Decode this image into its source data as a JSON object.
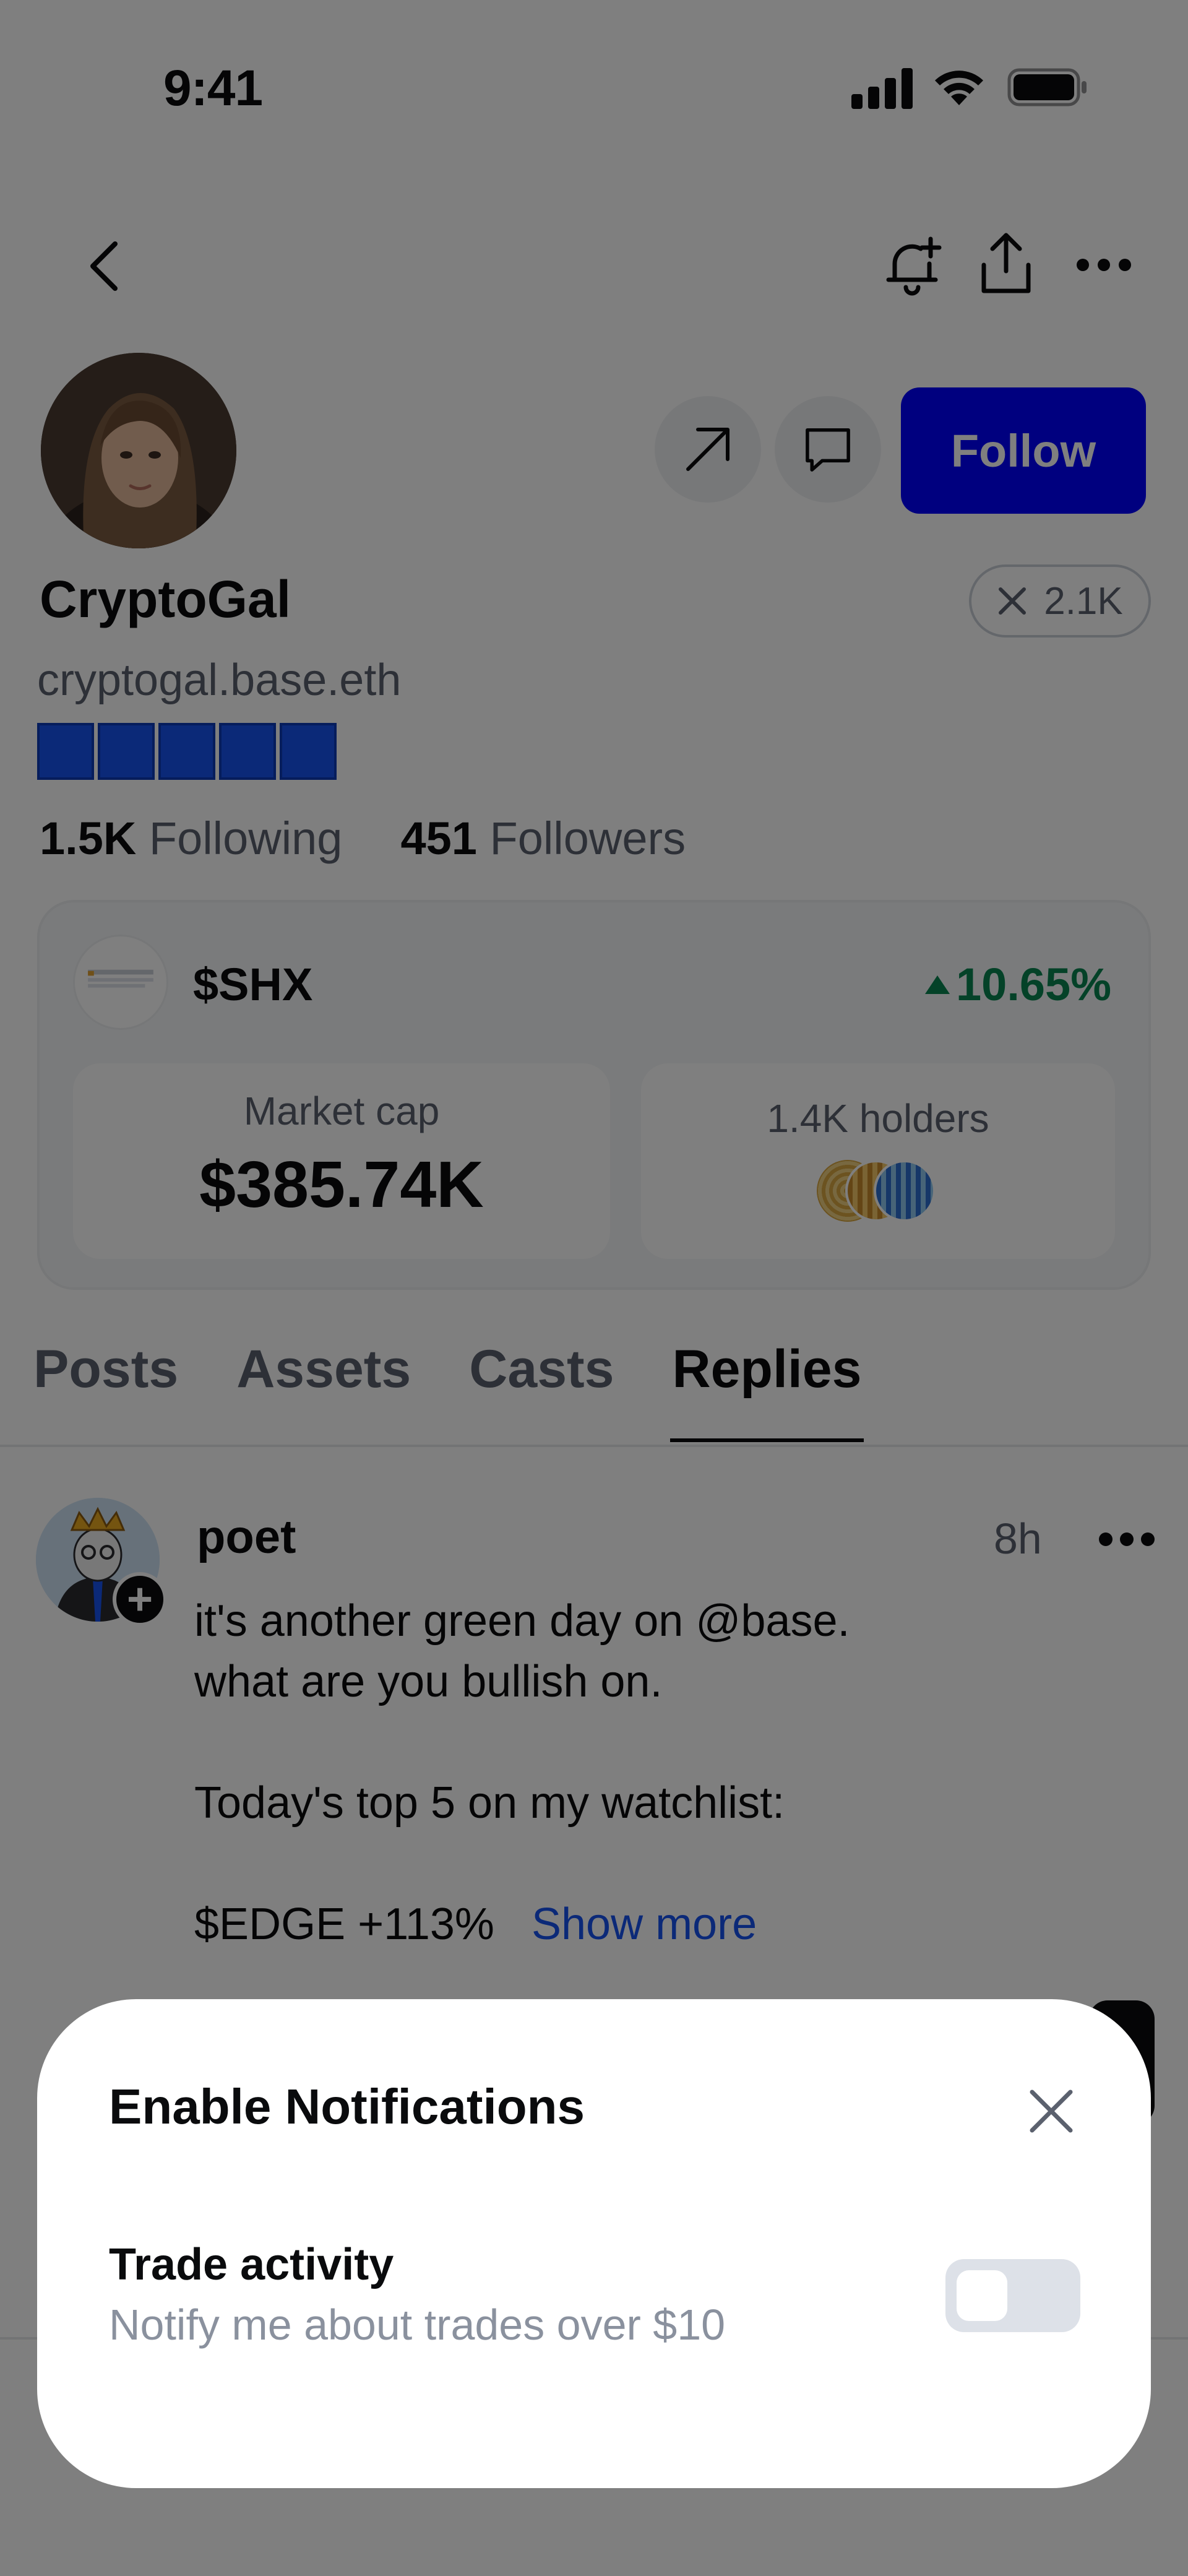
{
  "status_bar": {
    "time": "9:41"
  },
  "nav": {
    "back_icon": "chevron-left-icon",
    "bell_icon": "bell-plus-icon",
    "share_icon": "share-icon",
    "more_icon": "more-horizontal-icon"
  },
  "profile": {
    "name": "CryptoGal",
    "handle": "cryptogal.base.eth",
    "follow_label": "Follow",
    "x_followers": "2.1K",
    "following_count": "1.5K",
    "following_label": "Following",
    "followers_count": "451",
    "followers_label": "Followers"
  },
  "token": {
    "symbol": "$SHX",
    "change": "10.65%",
    "market_cap_label": "Market cap",
    "market_cap_value": "$385.74K",
    "holders_label": "1.4K holders"
  },
  "tabs": [
    {
      "label": "Posts",
      "active": false
    },
    {
      "label": "Assets",
      "active": false
    },
    {
      "label": "Casts",
      "active": false
    },
    {
      "label": "Replies",
      "active": true
    }
  ],
  "post": {
    "author": "poet",
    "time": "8h",
    "lines": [
      "it's another green day on @base.",
      "what are you bullish on.",
      "Today's top 5 on my watchlist:",
      "$EDGE +113%"
    ],
    "show_more": "Show more"
  },
  "sheet": {
    "title": "Enable Notifications",
    "row_title": "Trade activity",
    "row_subtitle": "Notify me about trades over $10",
    "toggle_on": false
  },
  "colors": {
    "accent": "#0000ff",
    "positive": "#098551",
    "link": "#1652f0"
  }
}
